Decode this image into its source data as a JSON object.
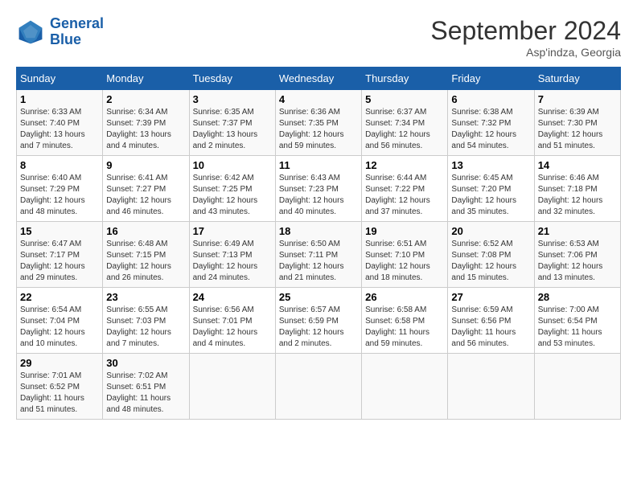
{
  "logo": {
    "line1": "General",
    "line2": "Blue"
  },
  "title": "September 2024",
  "location": "Asp'indza, Georgia",
  "days_of_week": [
    "Sunday",
    "Monday",
    "Tuesday",
    "Wednesday",
    "Thursday",
    "Friday",
    "Saturday"
  ],
  "weeks": [
    [
      {
        "day": "1",
        "info": "Sunrise: 6:33 AM\nSunset: 7:40 PM\nDaylight: 13 hours\nand 7 minutes."
      },
      {
        "day": "2",
        "info": "Sunrise: 6:34 AM\nSunset: 7:39 PM\nDaylight: 13 hours\nand 4 minutes."
      },
      {
        "day": "3",
        "info": "Sunrise: 6:35 AM\nSunset: 7:37 PM\nDaylight: 13 hours\nand 2 minutes."
      },
      {
        "day": "4",
        "info": "Sunrise: 6:36 AM\nSunset: 7:35 PM\nDaylight: 12 hours\nand 59 minutes."
      },
      {
        "day": "5",
        "info": "Sunrise: 6:37 AM\nSunset: 7:34 PM\nDaylight: 12 hours\nand 56 minutes."
      },
      {
        "day": "6",
        "info": "Sunrise: 6:38 AM\nSunset: 7:32 PM\nDaylight: 12 hours\nand 54 minutes."
      },
      {
        "day": "7",
        "info": "Sunrise: 6:39 AM\nSunset: 7:30 PM\nDaylight: 12 hours\nand 51 minutes."
      }
    ],
    [
      {
        "day": "8",
        "info": "Sunrise: 6:40 AM\nSunset: 7:29 PM\nDaylight: 12 hours\nand 48 minutes."
      },
      {
        "day": "9",
        "info": "Sunrise: 6:41 AM\nSunset: 7:27 PM\nDaylight: 12 hours\nand 46 minutes."
      },
      {
        "day": "10",
        "info": "Sunrise: 6:42 AM\nSunset: 7:25 PM\nDaylight: 12 hours\nand 43 minutes."
      },
      {
        "day": "11",
        "info": "Sunrise: 6:43 AM\nSunset: 7:23 PM\nDaylight: 12 hours\nand 40 minutes."
      },
      {
        "day": "12",
        "info": "Sunrise: 6:44 AM\nSunset: 7:22 PM\nDaylight: 12 hours\nand 37 minutes."
      },
      {
        "day": "13",
        "info": "Sunrise: 6:45 AM\nSunset: 7:20 PM\nDaylight: 12 hours\nand 35 minutes."
      },
      {
        "day": "14",
        "info": "Sunrise: 6:46 AM\nSunset: 7:18 PM\nDaylight: 12 hours\nand 32 minutes."
      }
    ],
    [
      {
        "day": "15",
        "info": "Sunrise: 6:47 AM\nSunset: 7:17 PM\nDaylight: 12 hours\nand 29 minutes."
      },
      {
        "day": "16",
        "info": "Sunrise: 6:48 AM\nSunset: 7:15 PM\nDaylight: 12 hours\nand 26 minutes."
      },
      {
        "day": "17",
        "info": "Sunrise: 6:49 AM\nSunset: 7:13 PM\nDaylight: 12 hours\nand 24 minutes."
      },
      {
        "day": "18",
        "info": "Sunrise: 6:50 AM\nSunset: 7:11 PM\nDaylight: 12 hours\nand 21 minutes."
      },
      {
        "day": "19",
        "info": "Sunrise: 6:51 AM\nSunset: 7:10 PM\nDaylight: 12 hours\nand 18 minutes."
      },
      {
        "day": "20",
        "info": "Sunrise: 6:52 AM\nSunset: 7:08 PM\nDaylight: 12 hours\nand 15 minutes."
      },
      {
        "day": "21",
        "info": "Sunrise: 6:53 AM\nSunset: 7:06 PM\nDaylight: 12 hours\nand 13 minutes."
      }
    ],
    [
      {
        "day": "22",
        "info": "Sunrise: 6:54 AM\nSunset: 7:04 PM\nDaylight: 12 hours\nand 10 minutes."
      },
      {
        "day": "23",
        "info": "Sunrise: 6:55 AM\nSunset: 7:03 PM\nDaylight: 12 hours\nand 7 minutes."
      },
      {
        "day": "24",
        "info": "Sunrise: 6:56 AM\nSunset: 7:01 PM\nDaylight: 12 hours\nand 4 minutes."
      },
      {
        "day": "25",
        "info": "Sunrise: 6:57 AM\nSunset: 6:59 PM\nDaylight: 12 hours\nand 2 minutes."
      },
      {
        "day": "26",
        "info": "Sunrise: 6:58 AM\nSunset: 6:58 PM\nDaylight: 11 hours\nand 59 minutes."
      },
      {
        "day": "27",
        "info": "Sunrise: 6:59 AM\nSunset: 6:56 PM\nDaylight: 11 hours\nand 56 minutes."
      },
      {
        "day": "28",
        "info": "Sunrise: 7:00 AM\nSunset: 6:54 PM\nDaylight: 11 hours\nand 53 minutes."
      }
    ],
    [
      {
        "day": "29",
        "info": "Sunrise: 7:01 AM\nSunset: 6:52 PM\nDaylight: 11 hours\nand 51 minutes."
      },
      {
        "day": "30",
        "info": "Sunrise: 7:02 AM\nSunset: 6:51 PM\nDaylight: 11 hours\nand 48 minutes."
      },
      null,
      null,
      null,
      null,
      null
    ]
  ]
}
